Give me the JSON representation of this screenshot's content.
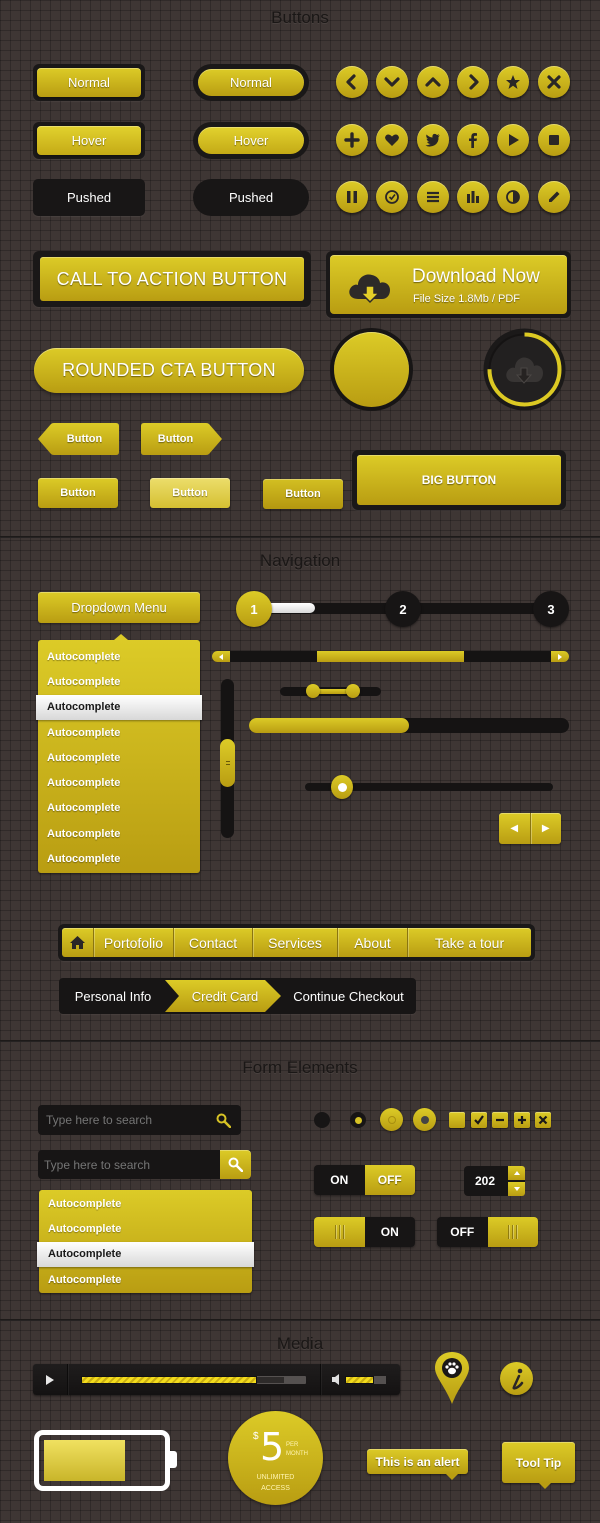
{
  "sections": {
    "buttons": "Buttons",
    "navigation": "Navigation",
    "forms": "Form Elements",
    "media": "Media"
  },
  "buttons": {
    "rect": [
      "Normal",
      "Hover",
      "Pushed"
    ],
    "pill": [
      "Normal",
      "Hover",
      "Pushed"
    ],
    "icon_rows": [
      [
        "chevron-left",
        "chevron-down",
        "chevron-up",
        "chevron-right",
        "star",
        "close"
      ],
      [
        "plus",
        "heart",
        "twitter",
        "facebook",
        "play",
        "stop"
      ],
      [
        "pause",
        "clock",
        "menu",
        "bar-chart",
        "contrast",
        "pencil"
      ]
    ],
    "cta": "CALL TO ACTION BUTTON",
    "download": {
      "title": "Download Now",
      "subtitle": "File Size 1.8Mb / PDF"
    },
    "rounded_cta": "ROUNDED CTA BUTTON",
    "download_progress_percent": 75,
    "arrow_left": "Button",
    "arrow_right": "Button",
    "small": [
      "Button",
      "Button",
      "Button"
    ],
    "big": "BIG BUTTON"
  },
  "navigation": {
    "dropdown_label": "Dropdown Menu",
    "dropdown_items": [
      "Autocomplete",
      "Autocomplete",
      "Autocomplete",
      "Autocomplete",
      "Autocomplete",
      "Autocomplete",
      "Autocomplete",
      "Autocomplete",
      "Autocomplete"
    ],
    "dropdown_selected_index": 2,
    "steps": [
      "1",
      "2",
      "3"
    ],
    "active_step": 1,
    "step_progress_percent": 15,
    "h_scroll": {
      "thumb_start": 0.27,
      "thumb_end": 0.73
    },
    "range_slider": {
      "low": 0.33,
      "high": 0.72
    },
    "progress_percent": 50,
    "single_slider": 0.15,
    "v_scroll": {
      "thumb_start": 0.38,
      "thumb_end": 0.68
    },
    "pager": {
      "prev": "◀",
      "next": "▶"
    },
    "menu": [
      "Portofolio",
      "Contact",
      "Services",
      "About",
      "Take a tour"
    ],
    "breadcrumb": [
      "Personal Info",
      "Credit Card",
      "Continue Checkout"
    ],
    "breadcrumb_active_index": 1
  },
  "forms": {
    "search1_placeholder": "Type here to search",
    "search2_placeholder": "Type here to search",
    "autocomplete": [
      "Autocomplete",
      "Autocomplete",
      "Autocomplete",
      "Autocomplete"
    ],
    "autocomplete_selected_index": 2,
    "switch1": {
      "on": "ON",
      "off": "OFF",
      "state": "off"
    },
    "stepper_value": "202",
    "switch2": {
      "label": "ON",
      "state": "off"
    },
    "switch3": {
      "label": "OFF",
      "state": "on"
    },
    "checkboxes": [
      "empty",
      "check",
      "minus",
      "plus",
      "x"
    ]
  },
  "media": {
    "player": {
      "progress_percent": 78,
      "buffered_percent": 90,
      "volume_percent": 70
    },
    "battery_percent": 70,
    "price": {
      "currency": "$",
      "amount": "5",
      "per1": "PER",
      "per2": "MONTH",
      "line1": "UNLIMITED",
      "line2": "ACCESS"
    },
    "alert": "This is an alert",
    "tooltip": "Tool Tip"
  },
  "colors": {
    "accent_light": "#dccb27",
    "accent_dark": "#b99d12",
    "frame": "#1a1818",
    "background": "#3e3634"
  }
}
